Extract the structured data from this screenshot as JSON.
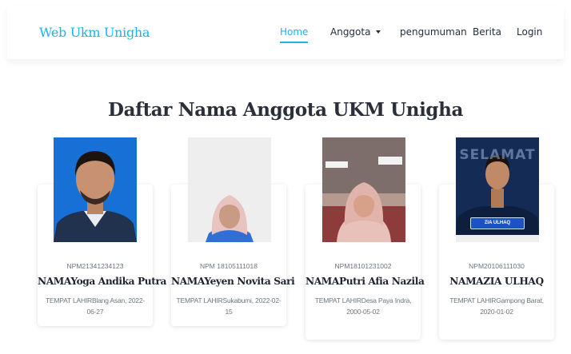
{
  "nav": {
    "brand": "Web Ukm Unigha",
    "items": [
      {
        "label": "Home",
        "active": true
      },
      {
        "label": "Anggota",
        "dropdown": true
      },
      {
        "label": "pengumuman"
      },
      {
        "label": "Berita"
      },
      {
        "label": "Login"
      }
    ]
  },
  "title": "Daftar Nama Anggota UKM Unigha",
  "members": [
    {
      "npm": "NPM21341234123",
      "name": "NAMAYoga Andika Putra",
      "birth": "TEMPAT LAHIRBlang Asan, 2022-06-27"
    },
    {
      "npm": "NPM 18105111018",
      "name": "NAMAYeyen Novita Sari",
      "birth": "TEMPAT LAHIRSukabumi, 2022-02-15"
    },
    {
      "npm": "NPM18101231002",
      "name": "NAMAPutri Afia Nazila",
      "birth": "TEMPAT LAHIRDesa Paya Indra, 2000-05-02"
    },
    {
      "npm": "NPM20106111030",
      "name": "NAMAZIA ULHAQ",
      "birth": "TEMPAT LAHIRGampong Barat, 2020-01-02",
      "photo_text": {
        "top": "SELAMAT",
        "bottom": "ZIA ULHAQ"
      }
    }
  ],
  "colors": {
    "accent": "#1bb3e8",
    "photo1_bg": "#1670d6",
    "photo2_bg": "#eeeeef",
    "photo4_bg": "#142b55"
  }
}
